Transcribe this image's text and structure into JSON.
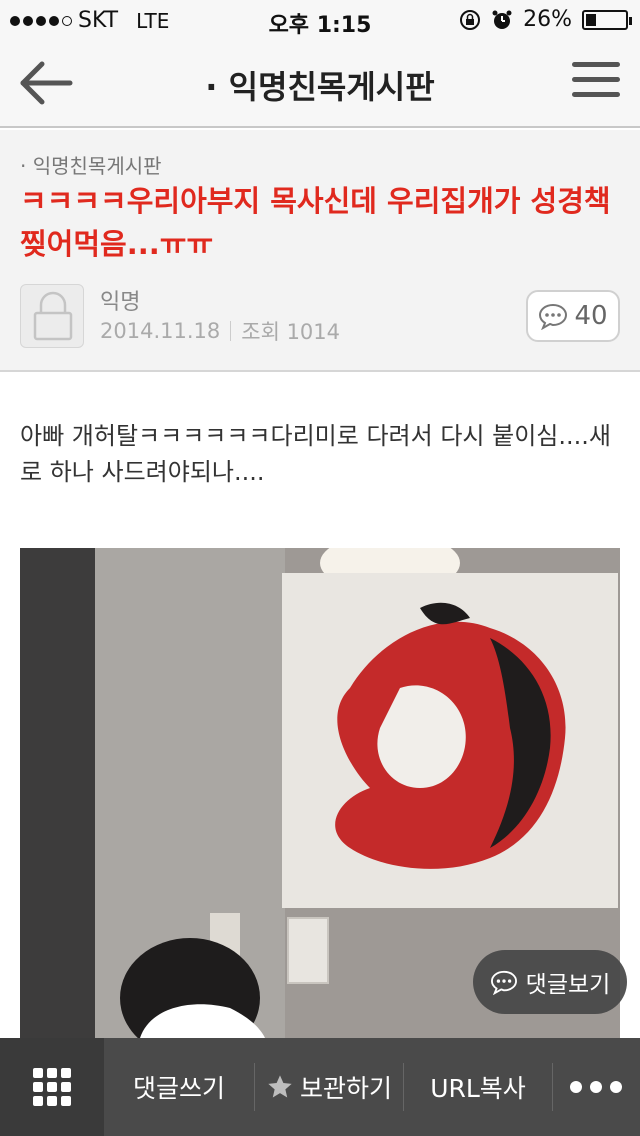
{
  "status_bar": {
    "carrier": "SKT",
    "network": "LTE",
    "time": "오후 1:15",
    "battery_percent": "26%",
    "battery_level": 0.26
  },
  "nav": {
    "title": "· 익명친목게시판"
  },
  "post": {
    "board": "· 익명친목게시판",
    "title": "ㅋㅋㅋㅋ우리아부지 목사신데 우리집개가 성경책 찢어먹음...ㅠㅠ",
    "author": "익명",
    "date": "2014.11.18",
    "views": "조회 1014",
    "comment_count": "40",
    "body": "아빠 개허탈ㅋㅋㅋㅋㅋㅋ다리미로 다려서 다시 붙이심....새로 하나 사드려야되나...."
  },
  "floating": {
    "view_comments": "댓글보기"
  },
  "toolbar": {
    "write_comment": "댓글쓰기",
    "save": "보관하기",
    "copy_url": "URL복사"
  },
  "colors": {
    "title_red": "#e0291e",
    "toolbar_bg": "#4a4a4a"
  }
}
